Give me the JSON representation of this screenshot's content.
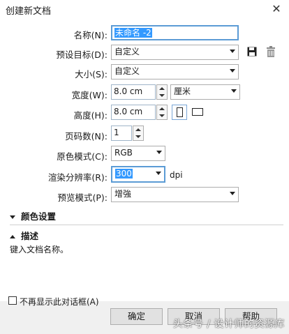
{
  "window": {
    "title": "创建新文档",
    "close_glyph": "✕"
  },
  "form": {
    "name": {
      "label": "名称(N):",
      "value": "未命名 -2"
    },
    "preset": {
      "label": "预设目标(D):",
      "value": "自定义",
      "save_icon": "save-icon",
      "delete_icon": "trash-icon"
    },
    "size": {
      "label": "大小(S):",
      "value": "自定义"
    },
    "width": {
      "label": "宽度(W):",
      "value": "8.0 cm",
      "unit": "厘米"
    },
    "height": {
      "label": "高度(H):",
      "value": "8.0 cm"
    },
    "pages": {
      "label": "页码数(N):",
      "value": "1"
    },
    "color_mode": {
      "label": "原色模式(C):",
      "value": "RGB"
    },
    "resolution": {
      "label": "渲染分辨率(R):",
      "value": "300",
      "unit": "dpi"
    },
    "preview": {
      "label": "预览模式(P):",
      "value": "增強"
    }
  },
  "sections": {
    "color_settings": "颜色设置",
    "description": "描述"
  },
  "description_text": "键入文档名称。",
  "checkbox": {
    "label": "不再显示此对话框(A)",
    "checked": false
  },
  "buttons": {
    "ok": "确定",
    "cancel": "取消",
    "help": "帮助"
  },
  "watermark": "头条号 / 设计师的资源库"
}
